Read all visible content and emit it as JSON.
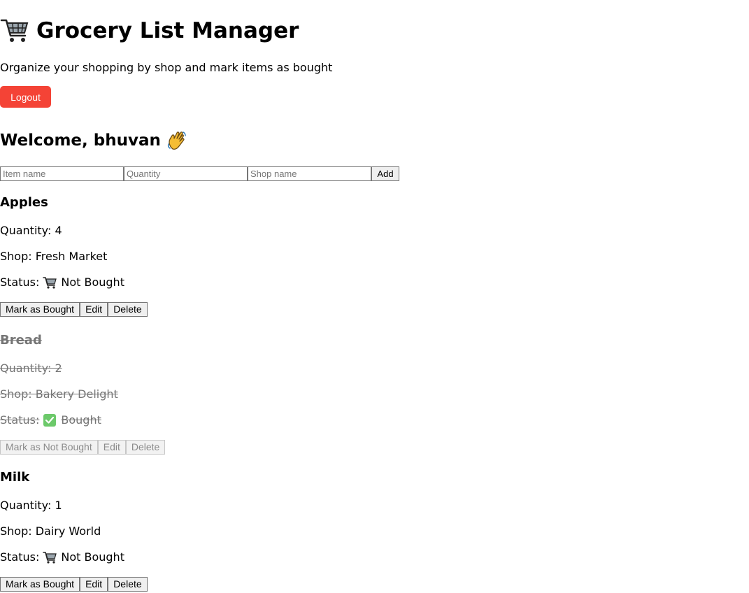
{
  "header": {
    "title": "Grocery List Manager",
    "subtitle": "Organize your shopping by shop and mark items as bought",
    "logout_label": "Logout",
    "logout_color": "#f44336"
  },
  "welcome": {
    "text": "Welcome, bhuvan"
  },
  "form": {
    "item_placeholder": "Item name",
    "quantity_placeholder": "Quantity",
    "shop_placeholder": "Shop name",
    "add_label": "Add"
  },
  "items": [
    {
      "name": "Apples",
      "quantity": "Quantity: 4",
      "shop": "Shop: Fresh Market",
      "status_label": "Status:",
      "status": "Not Bought",
      "status_icon": "cart-icon",
      "toggle_label": "Mark as Bought",
      "edit_label": "Edit",
      "delete_label": "Delete"
    },
    {
      "name": "Bread",
      "quantity": "Quantity: 2",
      "shop": "Shop: Bakery Delight",
      "status_label": "Status:",
      "status": "Bought",
      "status_icon": "check-icon",
      "toggle_label": "Mark as Not Bought",
      "edit_label": "Edit",
      "delete_label": "Delete"
    },
    {
      "name": "Milk",
      "quantity": "Quantity: 1",
      "shop": "Shop: Dairy World",
      "status_label": "Status:",
      "status": "Not Bought",
      "status_icon": "cart-icon",
      "toggle_label": "Mark as Bought",
      "edit_label": "Edit",
      "delete_label": "Delete"
    }
  ]
}
